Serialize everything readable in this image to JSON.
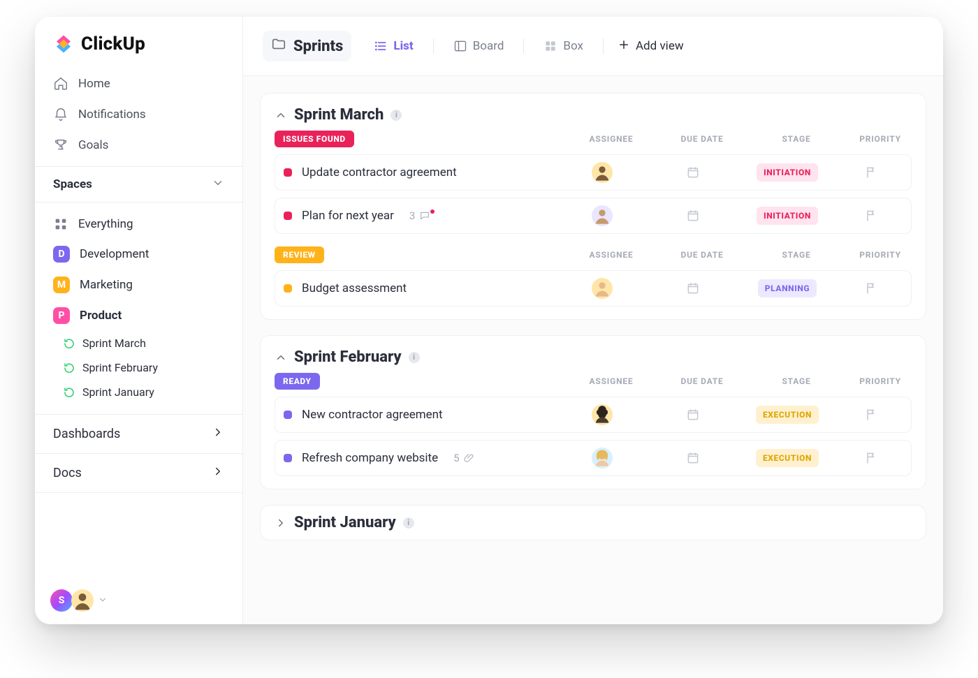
{
  "brand": {
    "name": "ClickUp"
  },
  "sidebar": {
    "home": "Home",
    "notifications": "Notifications",
    "goals": "Goals",
    "spaces_label": "Spaces",
    "everything": "Everything",
    "spaces": [
      {
        "letter": "D",
        "label": "Development",
        "chip": "chip-dev",
        "selected": false
      },
      {
        "letter": "M",
        "label": "Marketing",
        "chip": "chip-mkt",
        "selected": false
      },
      {
        "letter": "P",
        "label": "Product",
        "chip": "chip-prod",
        "selected": true
      }
    ],
    "product_children": [
      {
        "label": "Sprint  March"
      },
      {
        "label": "Sprint  February"
      },
      {
        "label": "Sprint January"
      }
    ],
    "dashboards": "Dashboards",
    "docs": "Docs",
    "profile_initial": "S"
  },
  "topbar": {
    "title": "Sprints",
    "views": {
      "list": "List",
      "board": "Board",
      "box": "Box",
      "add": "Add view"
    }
  },
  "columns": {
    "assignee": "ASSIGNEE",
    "due": "DUE DATE",
    "stage": "STAGE",
    "priority": "PRIORITY"
  },
  "stages": {
    "initiation": "INITIATION",
    "planning": "PLANNING",
    "execution": "EXECUTION"
  },
  "statuses": {
    "issues": "ISSUES FOUND",
    "review": "REVIEW",
    "ready": "READY"
  },
  "panels": {
    "march": {
      "title": "Sprint March"
    },
    "feb": {
      "title": "Sprint February"
    },
    "jan": {
      "title": "Sprint January"
    }
  },
  "tasks_march_issues": [
    {
      "title": "Update contractor agreement",
      "comments": null,
      "attachments": null,
      "stage": "initiation",
      "avatar_bg": "#ffe6a8"
    },
    {
      "title": "Plan for next year",
      "comments": 3,
      "attachments": null,
      "stage": "initiation",
      "avatar_bg": "#e9e6ff"
    }
  ],
  "tasks_march_review": [
    {
      "title": "Budget assessment",
      "comments": null,
      "attachments": null,
      "stage": "planning",
      "avatar_bg": "#ffe6a8"
    }
  ],
  "tasks_feb_ready": [
    {
      "title": "New contractor agreement",
      "comments": null,
      "attachments": null,
      "stage": "execution",
      "avatar_bg": "#ffe6a8"
    },
    {
      "title": "Refresh company website",
      "comments": null,
      "attachments": 5,
      "stage": "execution",
      "avatar_bg": "#d8f0ff"
    }
  ]
}
